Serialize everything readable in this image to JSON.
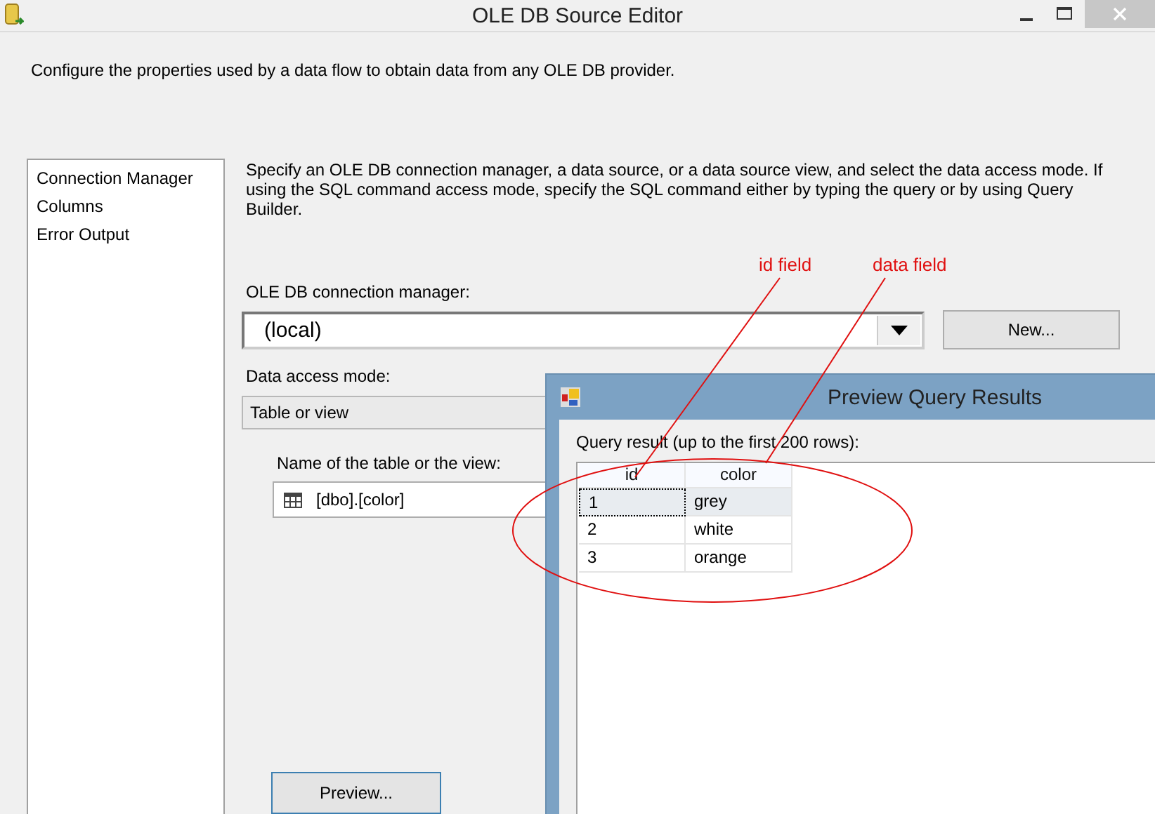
{
  "window": {
    "title": "OLE DB Source Editor",
    "description": "Configure the properties used by a data flow to obtain data from any OLE DB provider."
  },
  "sidebar": {
    "items": [
      {
        "label": "Connection Manager"
      },
      {
        "label": "Columns"
      },
      {
        "label": "Error Output"
      }
    ]
  },
  "content": {
    "instructions": "Specify an OLE DB connection manager, a data source, or a data source view, and select the data access mode. If using the SQL command access mode, specify the SQL command either by typing the query or by using Query Builder.",
    "connection_label": "OLE DB connection manager:",
    "connection_value": "(local)",
    "new_button": "New...",
    "access_mode_label": "Data access mode:",
    "access_mode_value": "Table or view",
    "table_label": "Name of the table or the view:",
    "table_value": "[dbo].[color]",
    "preview_button": "Preview..."
  },
  "preview_dialog": {
    "title": "Preview Query Results",
    "label": "Query result (up to the first 200 rows):",
    "columns": [
      "id",
      "color"
    ],
    "rows": [
      {
        "cells": [
          "1",
          "grey"
        ],
        "selected": true
      },
      {
        "cells": [
          "2",
          "white"
        ],
        "selected": false
      },
      {
        "cells": [
          "3",
          "orange"
        ],
        "selected": false
      }
    ]
  },
  "annotations": [
    {
      "label": "id field"
    },
    {
      "label": "data field"
    }
  ]
}
